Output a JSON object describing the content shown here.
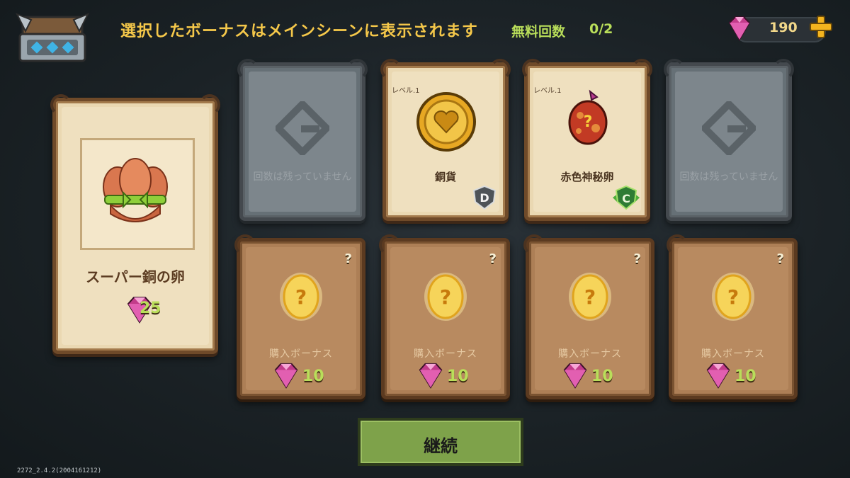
{
  "header": {
    "message": "選択したボーナスはメインシーンに表示されます",
    "free_label": "無料回数",
    "free_count": "0/2",
    "gems": "190"
  },
  "featured": {
    "name": "スーパー銅の卵",
    "price": "25"
  },
  "top_cards": [
    {
      "type": "empty",
      "text": "回数は残っていません"
    },
    {
      "type": "item",
      "level": "レベル.1",
      "name": "銅貨",
      "grade": "D"
    },
    {
      "type": "item",
      "level": "レベル.1",
      "name": "赤色神秘卵",
      "grade": "C"
    },
    {
      "type": "empty",
      "text": "回数は残っていません"
    }
  ],
  "bonus_cards": [
    {
      "label": "購入ボーナス",
      "price": "10",
      "q": "?"
    },
    {
      "label": "購入ボーナス",
      "price": "10",
      "q": "?"
    },
    {
      "label": "購入ボーナス",
      "price": "10",
      "q": "?"
    },
    {
      "label": "購入ボーナス",
      "price": "10",
      "q": "?"
    }
  ],
  "continue_label": "継続",
  "version": "2272_2.4.2(2004161212)",
  "colors": {
    "gold_text": "#f5c84a",
    "green_text": "#b9de5a",
    "gem": "#c23b8a"
  }
}
